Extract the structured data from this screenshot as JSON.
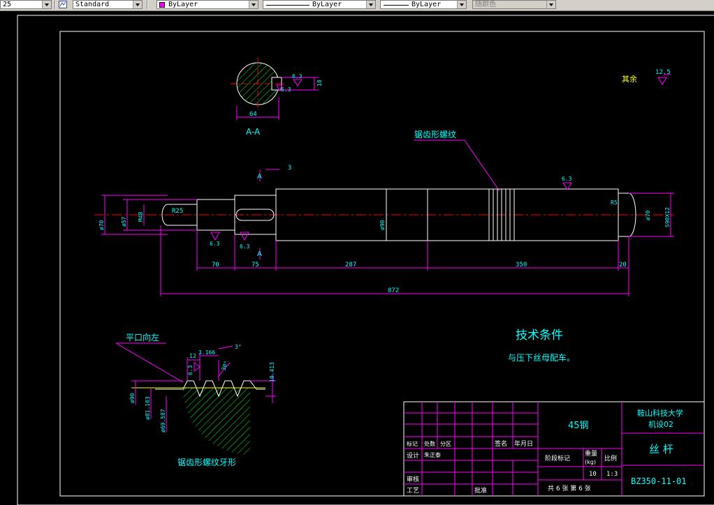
{
  "toolbar": {
    "scale_value": "25",
    "text_style": "Standard",
    "layer_color": "ByLayer",
    "linetype": "ByLayer",
    "lineweight": "ByLayer",
    "plot_style": "随颜色"
  },
  "colors": {
    "background": "#000000",
    "frame": "#ffffff",
    "dimension": "#ff00ff",
    "text": "#00ffff",
    "centerline": "#ff0000",
    "hatch": "#00ff00",
    "thread": "#ffff00"
  },
  "section": {
    "label": "A-A",
    "dim_width": "64",
    "dim_keyway": "18",
    "roughness_1": "6.3",
    "roughness_2": "6.3"
  },
  "surface_rest": {
    "label": "其余",
    "value": "12.5"
  },
  "thread_callout": "锯齿形螺纹",
  "shaft": {
    "dim_a": "A",
    "dim_a2": "A",
    "dim_3": "3",
    "dia_70": "ø70",
    "dia_57": "ø57",
    "dia_m48": "M48",
    "r25": "R25",
    "dia_90": "ø90",
    "r_end": "R5",
    "dia_70_right": "ø70",
    "s90": "S90X12",
    "rough_left_1": "6.3",
    "rough_left_2": "6.3",
    "rough_right": "6.3",
    "len_70": "70",
    "len_75": "75",
    "len_287": "287",
    "len_350": "350",
    "len_20": "20",
    "len_total": "872"
  },
  "thread_detail": {
    "title": "锯齿形螺纹牙形",
    "direction": "平口向左",
    "dim_12": "12",
    "dim_3166": "3.166",
    "dim_3deg": "3°",
    "dim_30deg": "30°",
    "dim_10413": "10.413",
    "dim_63": "6.3",
    "dia_90": "ø90",
    "dia_81": "ø81.103",
    "dia_69": "ø69.587"
  },
  "tech_req": {
    "title": "技术条件",
    "item": "与压下丝母配车。"
  },
  "title_block": {
    "material": "45钢",
    "school": "鞍山科技大学",
    "class": "机设02",
    "part_name": "丝 杆",
    "drawing_no": "BZ350-11-01",
    "stage_mark": "阶段标记",
    "weight": "重量",
    "weight_unit": "(kg)",
    "scale_label": "比例",
    "weight_value": "10",
    "scale_value": "1:3",
    "sheets": "共 6 张  第 6 张",
    "sign": "签名",
    "date": "年月日",
    "design": "设计",
    "designer": "朱正泰",
    "review": "审核",
    "process": "工艺",
    "approve": "批准",
    "mark": "标记",
    "count": "处数",
    "zone": "分区"
  }
}
